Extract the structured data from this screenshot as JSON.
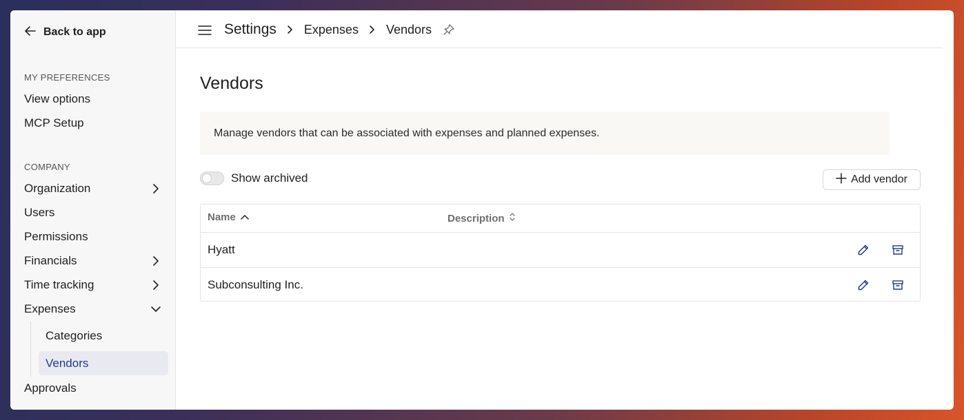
{
  "sidebar": {
    "back_label": "Back to app",
    "sections": {
      "preferences": "MY PREFERENCES",
      "company": "COMPANY"
    },
    "preferences_items": [
      "View options",
      "MCP Setup"
    ],
    "company_items": {
      "organization": "Organization",
      "users": "Users",
      "permissions": "Permissions",
      "financials": "Financials",
      "time_tracking": "Time tracking",
      "expenses": "Expenses",
      "approvals": "Approvals"
    },
    "expenses_sub": {
      "categories": "Categories",
      "vendors": "Vendors"
    }
  },
  "header": {
    "title": "Settings",
    "crumbs": [
      "Expenses",
      "Vendors"
    ]
  },
  "main": {
    "title": "Vendors",
    "info": "Manage vendors that can be associated with expenses and planned expenses.",
    "show_archived_label": "Show archived",
    "add_button_label": "Add vendor",
    "table": {
      "columns": [
        "Name",
        "Description"
      ],
      "rows": [
        {
          "name": "Hyatt",
          "description": ""
        },
        {
          "name": "Subconsulting Inc.",
          "description": ""
        }
      ]
    }
  },
  "colors": {
    "accent": "#1f3a8a",
    "active_bg": "#e9eaf1",
    "icon_blue": "#1f3a8a"
  }
}
